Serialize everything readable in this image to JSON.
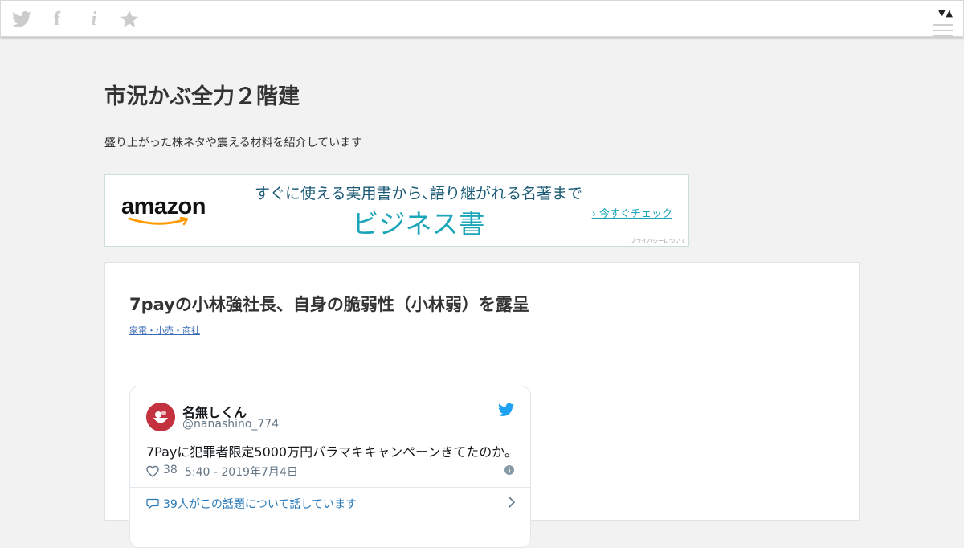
{
  "toolbar": {
    "icons": [
      "twitter-icon",
      "facebook-icon",
      "info-icon",
      "star-icon"
    ],
    "facebook_glyph": "f",
    "info_glyph": "i",
    "arrows": "▼▲"
  },
  "site": {
    "title": "市況かぶ全力２階建",
    "description": "盛り上がった株ネタや震える材料を紹介しています"
  },
  "ad": {
    "logo": "amazon",
    "tagline": "すぐに使える実用書から､語り継がれる名著まで",
    "headline": "ビジネス書",
    "cta": "› 今すぐチェック",
    "privacy": "プライバシーについて",
    "colors": {
      "teal": "#1aa5b8",
      "navy": "#1b5a76",
      "smile": "#f90"
    }
  },
  "article": {
    "title": "7payの小林強社長、自身の脆弱性（小林弱）を露呈",
    "category": "家電・小売・商社"
  },
  "tweet": {
    "name": "名無しくん",
    "handle": "@nanashino_774",
    "text": "7Payに犯罪者限定5000万円バラマキキャンペーンきてたのか。",
    "likes": "38",
    "time": "5:40 - 2019年7月4日",
    "talk": "39人がこの話題について話しています",
    "colors": {
      "link": "#2b7bb9",
      "bird": "#1da1f2"
    }
  }
}
